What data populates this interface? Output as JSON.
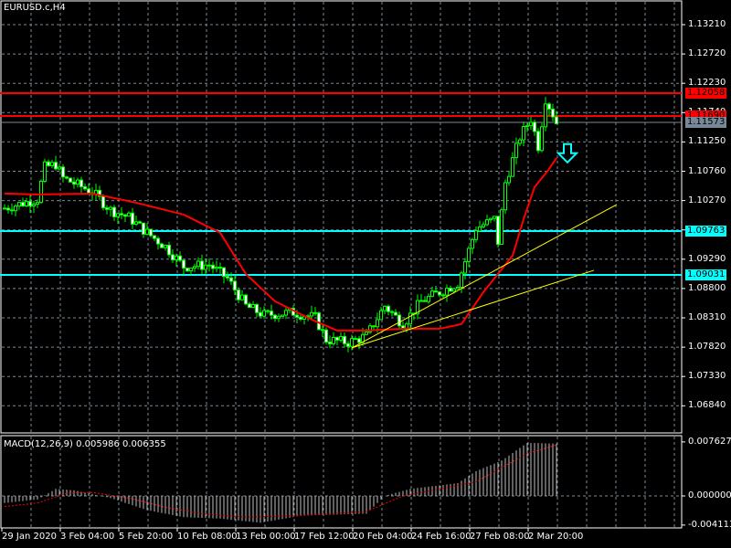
{
  "window": {
    "title": "EURUSD.c,H4"
  },
  "colors": {
    "bull_wick": "#00ff00",
    "ma": "#ff0000",
    "resistance": "#ff0000",
    "support": "#00ffff",
    "trend": "#ffff00",
    "grid": "#778899",
    "bid_line": "#778899"
  },
  "price_axis": {
    "ticks": [
      "1.13210",
      "1.12720",
      "1.12230",
      "1.11740",
      "1.11250",
      "1.10760",
      "1.10270",
      "1.09780",
      "1.09290",
      "1.08800",
      "1.08310",
      "1.07820",
      "1.07330",
      "1.06840"
    ],
    "tick_values": [
      1.1321,
      1.1272,
      1.1223,
      1.1174,
      1.1125,
      1.1076,
      1.1027,
      1.0978,
      1.0929,
      1.088,
      1.0831,
      1.0782,
      1.0733,
      1.0684
    ]
  },
  "levels": [
    {
      "label": "1.12058",
      "price": 1.12058,
      "type": "resistance"
    },
    {
      "label": "1.11690",
      "price": 1.1169,
      "type": "resistance"
    },
    {
      "label": "1.11573",
      "price": 1.11573,
      "type": "bid"
    },
    {
      "label": "1.09763",
      "price": 1.09763,
      "type": "support"
    },
    {
      "label": "1.09031",
      "price": 1.09031,
      "type": "support"
    }
  ],
  "time_axis": [
    "29 Jan 2020",
    "3 Feb 04:00",
    "5 Feb 20:00",
    "10 Feb 08:00",
    "13 Feb 00:00",
    "17 Feb 12:00",
    "20 Feb 04:00",
    "24 Feb 16:00",
    "27 Feb 08:00",
    "2 Mar 20:00"
  ],
  "macd": {
    "title": "MACD(12,26,9) 0.005986 0.006355",
    "ticks": [
      "0.007627",
      "0.000000",
      "-0.004113"
    ],
    "max": 0.007627,
    "min": -0.004113
  },
  "chart_data": {
    "type": "candlestick",
    "symbol": "EURUSD.c",
    "timeframe": "H4",
    "bars": 152,
    "price_range": [
      1.066,
      1.137
    ],
    "close_keypoints": [
      [
        0,
        1.10143
      ],
      [
        9,
        1.10295
      ],
      [
        11,
        1.10829
      ],
      [
        14,
        1.10875
      ],
      [
        16,
        1.10646
      ],
      [
        24,
        1.10417
      ],
      [
        29,
        1.10112
      ],
      [
        34,
        1.0999
      ],
      [
        39,
        1.09731
      ],
      [
        44,
        1.09502
      ],
      [
        49,
        1.09166
      ],
      [
        56,
        1.09197
      ],
      [
        61,
        1.08968
      ],
      [
        66,
        1.0851
      ],
      [
        71,
        1.08357
      ],
      [
        79,
        1.08403
      ],
      [
        85,
        1.08312
      ],
      [
        88,
        1.07945
      ],
      [
        94,
        1.079
      ],
      [
        99,
        1.08006
      ],
      [
        104,
        1.0851
      ],
      [
        109,
        1.08205
      ],
      [
        114,
        1.08586
      ],
      [
        119,
        1.08739
      ],
      [
        124,
        1.08891
      ],
      [
        129,
        1.09807
      ],
      [
        134,
        1.0996
      ],
      [
        135,
        1.09578
      ],
      [
        137,
        1.1057
      ],
      [
        141,
        1.11333
      ],
      [
        144,
        1.11638
      ],
      [
        146,
        1.1118
      ],
      [
        148,
        1.11974
      ],
      [
        150,
        1.11715
      ],
      [
        151,
        1.11573
      ]
    ],
    "ma_keypoints": [
      [
        0,
        1.10387
      ],
      [
        9,
        1.10372
      ],
      [
        24,
        1.10387
      ],
      [
        36,
        1.10234
      ],
      [
        49,
        1.10036
      ],
      [
        59,
        1.09731
      ],
      [
        66,
        1.09044
      ],
      [
        74,
        1.08586
      ],
      [
        84,
        1.08281
      ],
      [
        91,
        1.08098
      ],
      [
        99,
        1.08098
      ],
      [
        109,
        1.08128
      ],
      [
        119,
        1.08128
      ],
      [
        125,
        1.08205
      ],
      [
        131,
        1.08739
      ],
      [
        139,
        1.09349
      ],
      [
        142,
        1.0996
      ],
      [
        145,
        1.10494
      ],
      [
        149,
        1.10799
      ],
      [
        151,
        1.10982
      ]
    ],
    "trendlines": [
      {
        "from": [
          95,
          1.07808
        ],
        "to": [
          167.5,
          1.10204
        ]
      },
      {
        "from": [
          95,
          1.07808
        ],
        "to": [
          161.25,
          1.09105
        ]
      }
    ],
    "arrow": {
      "bar": 154,
      "price": 1.11,
      "direction": "down"
    },
    "macd_keypoints": [
      [
        0,
        -0.001
      ],
      [
        9,
        -0.0005
      ],
      [
        14,
        0.001
      ],
      [
        19,
        0.0008
      ],
      [
        29,
        -0.0003
      ],
      [
        39,
        -0.002
      ],
      [
        49,
        -0.003
      ],
      [
        59,
        -0.0032
      ],
      [
        70,
        -0.0038
      ],
      [
        81,
        -0.0028
      ],
      [
        99,
        -0.0025
      ],
      [
        104,
        0.0
      ],
      [
        111,
        0.001
      ],
      [
        124,
        0.0018
      ],
      [
        129,
        0.0035
      ],
      [
        136,
        0.005
      ],
      [
        143,
        0.0075
      ],
      [
        151,
        0.0074
      ]
    ],
    "signal_keypoints": [
      [
        0,
        -0.0015
      ],
      [
        9,
        -0.001
      ],
      [
        17,
        0.0004
      ],
      [
        24,
        0.0005
      ],
      [
        34,
        -0.0003
      ],
      [
        44,
        -0.0016
      ],
      [
        54,
        -0.0025
      ],
      [
        66,
        -0.003
      ],
      [
        79,
        -0.0028
      ],
      [
        99,
        -0.0022
      ],
      [
        109,
        0.0
      ],
      [
        119,
        0.001
      ],
      [
        129,
        0.002
      ],
      [
        136,
        0.004
      ],
      [
        143,
        0.006
      ],
      [
        151,
        0.0072
      ]
    ]
  }
}
